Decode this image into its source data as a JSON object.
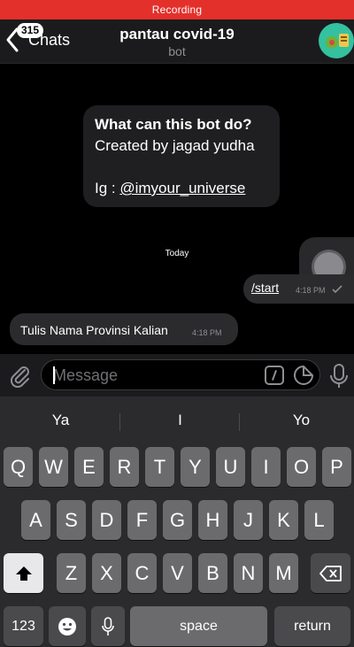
{
  "status_bar": {
    "recording_text": "Recording"
  },
  "header": {
    "back_badge": "315",
    "back_label": "Chats",
    "title": "pantau covid-19",
    "subtitle": "bot"
  },
  "chat": {
    "bot_info": {
      "heading": "What can this bot do?",
      "line1": "Created by jagad yudha",
      "ig_prefix": "Ig : ",
      "ig_handle": "@imyour_universe"
    },
    "date_label": "Today",
    "outgoing": {
      "text": "/start",
      "time": "4:18 PM"
    },
    "incoming": {
      "text": "Tulis Nama Provinsi Kalian",
      "time": "4:18 PM"
    }
  },
  "composer": {
    "placeholder": "Message"
  },
  "keyboard": {
    "suggestions": [
      "Ya",
      "I",
      "Yo"
    ],
    "row1": [
      "Q",
      "W",
      "E",
      "R",
      "T",
      "Y",
      "U",
      "I",
      "O",
      "P"
    ],
    "row2": [
      "A",
      "S",
      "D",
      "F",
      "G",
      "H",
      "J",
      "K",
      "L"
    ],
    "row3": [
      "Z",
      "X",
      "C",
      "V",
      "B",
      "N",
      "M"
    ],
    "numbers_label": "123",
    "space_label": "space",
    "return_label": "return"
  },
  "colors": {
    "recording": "#e3302b",
    "bubble": "#2b2b2e",
    "avatar": "#34c1a0"
  }
}
